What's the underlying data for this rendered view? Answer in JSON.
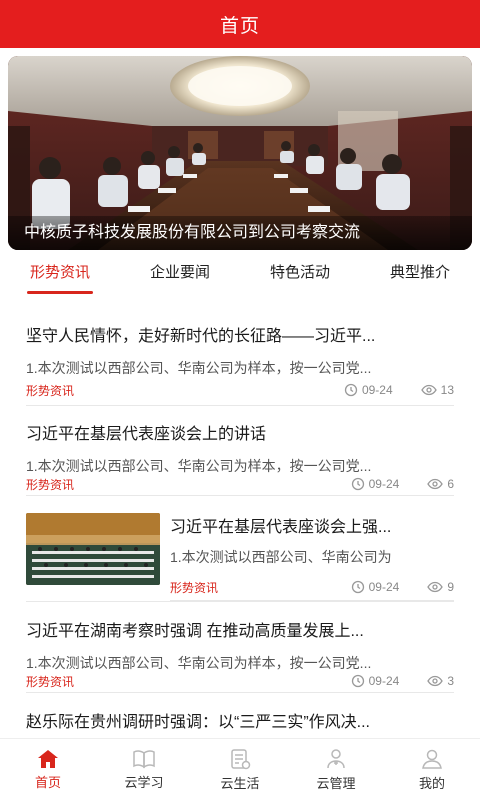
{
  "header": {
    "title": "首页"
  },
  "banner": {
    "caption": "中核质子科技发展股份有限公司到公司考察交流"
  },
  "tabs": [
    {
      "label": "形势资讯",
      "active": true
    },
    {
      "label": "企业要闻",
      "active": false
    },
    {
      "label": "特色活动",
      "active": false
    },
    {
      "label": "典型推介",
      "active": false
    }
  ],
  "news": [
    {
      "title": "坚守人民情怀，走好新时代的长征路——习近平...",
      "summary": "1.本次测试以西部公司、华南公司为样本，按一公司党...",
      "tag": "形势资讯",
      "date": "09-24",
      "views": "13",
      "has_image": false
    },
    {
      "title": "习近平在基层代表座谈会上的讲话",
      "summary": "1.本次测试以西部公司、华南公司为样本，按一公司党...",
      "tag": "形势资讯",
      "date": "09-24",
      "views": "6",
      "has_image": false
    },
    {
      "title": "习近平在基层代表座谈会上强...",
      "summary": "1.本次测试以西部公司、华南公司为",
      "tag": "形势资讯",
      "date": "09-24",
      "views": "9",
      "has_image": true
    },
    {
      "title": "习近平在湖南考察时强调 在推动高质量发展上...",
      "summary": "1.本次测试以西部公司、华南公司为样本，按一公司党...",
      "tag": "形势资讯",
      "date": "09-24",
      "views": "3",
      "has_image": false
    },
    {
      "title": "赵乐际在贵州调研时强调：以“三严三实”作风决...",
      "summary": "",
      "tag": "",
      "date": "",
      "views": "",
      "has_image": false
    }
  ],
  "tabbar": [
    {
      "label": "首页",
      "icon": "home-icon",
      "active": true
    },
    {
      "label": "云学习",
      "icon": "book-icon",
      "active": false
    },
    {
      "label": "云生活",
      "icon": "life-document-icon",
      "active": false
    },
    {
      "label": "云管理",
      "icon": "manage-person-icon",
      "active": false
    },
    {
      "label": "我的",
      "icon": "user-profile-icon",
      "active": false
    }
  ],
  "colors": {
    "primary_red": "#e41e1e",
    "accent_red": "#d8261c",
    "text": "#1a1a1a",
    "muted": "#888888"
  }
}
